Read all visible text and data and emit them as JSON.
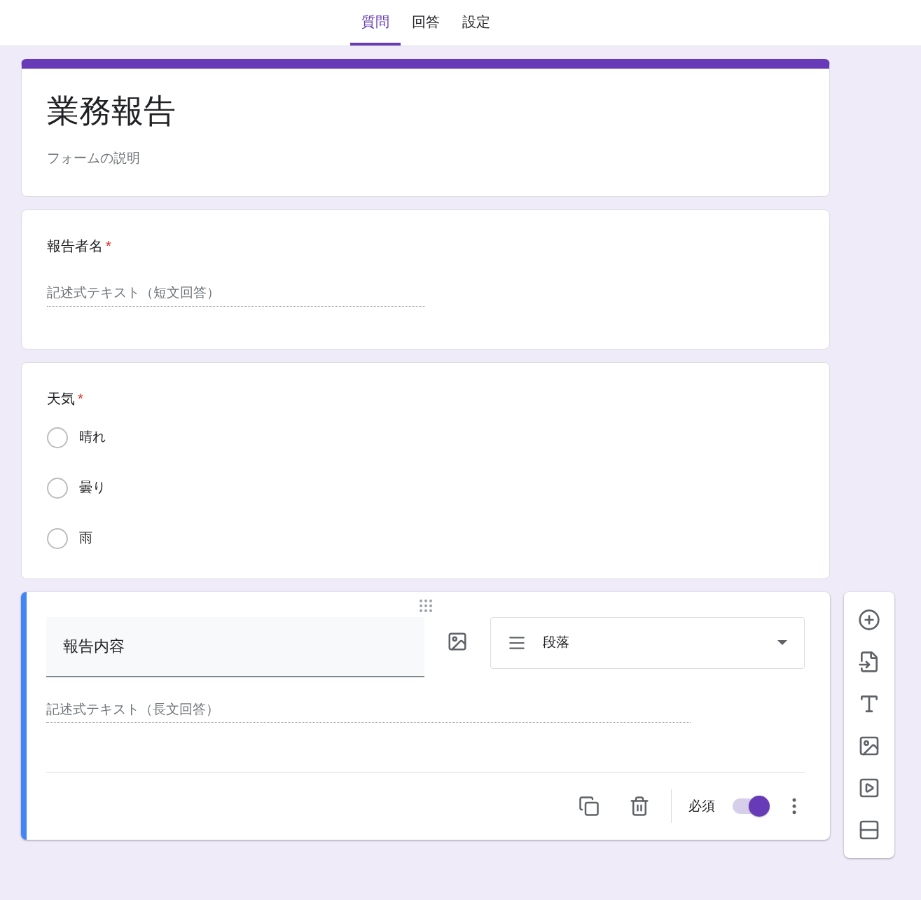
{
  "tabs": [
    {
      "label": "質問",
      "selected": true
    },
    {
      "label": "回答",
      "selected": false
    },
    {
      "label": "設定",
      "selected": false
    }
  ],
  "form": {
    "title": "業務報告",
    "description": "フォームの説明"
  },
  "questions": [
    {
      "kind": "short",
      "title": "報告者名",
      "required_mark": "*",
      "placeholder": "記述式テキスト（短文回答）"
    },
    {
      "kind": "radio",
      "title": "天気",
      "required_mark": "*",
      "options": [
        {
          "label": "晴れ",
          "selected": false
        },
        {
          "label": "曇り",
          "selected": false
        },
        {
          "label": "雨",
          "selected": false
        }
      ]
    },
    {
      "kind": "editing",
      "title": "報告内容",
      "type_label": "段落",
      "placeholder": "記述式テキスト（長文回答）",
      "required_label": "必須",
      "required": true
    }
  ]
}
